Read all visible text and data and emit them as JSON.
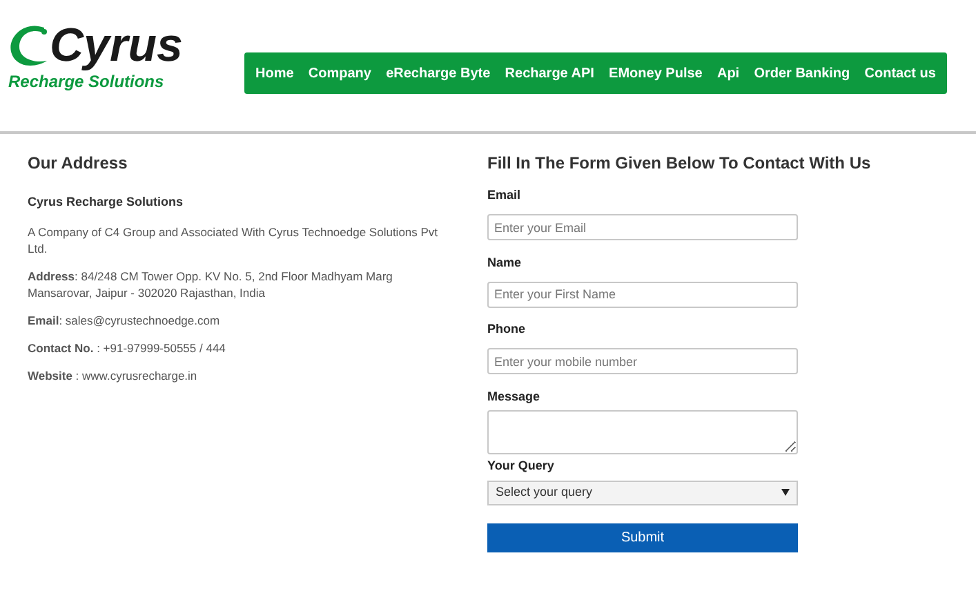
{
  "logo": {
    "name": "Cyrus",
    "tagline": "Recharge Solutions"
  },
  "nav": [
    {
      "label": "Home"
    },
    {
      "label": "Company"
    },
    {
      "label": "eRecharge Byte"
    },
    {
      "label": "Recharge API"
    },
    {
      "label": "EMoney Pulse"
    },
    {
      "label": "Api"
    },
    {
      "label": "Order Banking"
    },
    {
      "label": "Contact us"
    }
  ],
  "address": {
    "title": "Our Address",
    "company": "Cyrus Recharge Solutions",
    "lines": [
      "A Company of C4 Group and Associated With Cyrus Technoedge Solutions Pvt Ltd.",
      "**Address**: 84/248 CM Tower Opp. KV No. 5, 2nd Floor Madhyam Marg Mansarovar, Jaipur - 302020 Rajasthan, India",
      "**Email**: sales@cyrustechnoedge.com",
      "**Contact No.** : +91-97999-50555 / 444",
      "**Website** : www.cyrusrecharge.in"
    ]
  },
  "form": {
    "title": "Fill In The Form Given Below To Contact With Us",
    "fields": [
      {
        "kind": "input",
        "label": "Email",
        "placeholder": "Enter your Email"
      },
      {
        "kind": "input",
        "label": "Name",
        "placeholder": "Enter your First Name"
      },
      {
        "kind": "input",
        "label": "Phone",
        "placeholder": "Enter your mobile number"
      },
      {
        "kind": "textarea",
        "label": "Message"
      },
      {
        "kind": "select",
        "label": "Your Query",
        "value": "Select your query"
      }
    ],
    "submit": "Submit"
  }
}
